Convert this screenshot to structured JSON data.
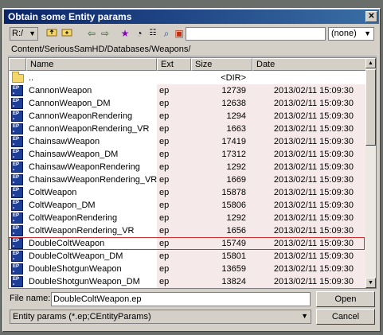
{
  "window": {
    "title": "Obtain some Entity params"
  },
  "toolbar": {
    "drive": "R:/",
    "path_value": "",
    "filter": "(none)",
    "icons": [
      "folder-up-icon",
      "folder-new-icon",
      "back-arrow-icon",
      "forward-arrow-icon",
      "star-icon",
      "clock-icon",
      "list-view-icon",
      "search-icon",
      "bookmark-icon"
    ]
  },
  "path": "Content/SeriousSamHD/Databases/Weapons/",
  "columns": {
    "name": "Name",
    "ext": "Ext",
    "size": "Size",
    "date": "Date"
  },
  "files": [
    {
      "name": "..",
      "ext": "",
      "size": "<DIR>",
      "date": ""
    },
    {
      "name": "CannonWeapon",
      "ext": "ep",
      "size": "12739",
      "date": "2013/02/11 15:09:30"
    },
    {
      "name": "CannonWeapon_DM",
      "ext": "ep",
      "size": "12638",
      "date": "2013/02/11 15:09:30"
    },
    {
      "name": "CannonWeaponRendering",
      "ext": "ep",
      "size": "1294",
      "date": "2013/02/11 15:09:30"
    },
    {
      "name": "CannonWeaponRendering_VR",
      "ext": "ep",
      "size": "1663",
      "date": "2013/02/11 15:09:30"
    },
    {
      "name": "ChainsawWeapon",
      "ext": "ep",
      "size": "17419",
      "date": "2013/02/11 15:09:30"
    },
    {
      "name": "ChainsawWeapon_DM",
      "ext": "ep",
      "size": "17312",
      "date": "2013/02/11 15:09:30"
    },
    {
      "name": "ChainsawWeaponRendering",
      "ext": "ep",
      "size": "1292",
      "date": "2013/02/11 15:09:30"
    },
    {
      "name": "ChainsawWeaponRendering_VR",
      "ext": "ep",
      "size": "1669",
      "date": "2013/02/11 15:09:30"
    },
    {
      "name": "ColtWeapon",
      "ext": "ep",
      "size": "15878",
      "date": "2013/02/11 15:09:30"
    },
    {
      "name": "ColtWeapon_DM",
      "ext": "ep",
      "size": "15806",
      "date": "2013/02/11 15:09:30"
    },
    {
      "name": "ColtWeaponRendering",
      "ext": "ep",
      "size": "1292",
      "date": "2013/02/11 15:09:30"
    },
    {
      "name": "ColtWeaponRendering_VR",
      "ext": "ep",
      "size": "1656",
      "date": "2013/02/11 15:09:30"
    },
    {
      "name": "DoubleColtWeapon",
      "ext": "ep",
      "size": "15749",
      "date": "2013/02/11 15:09:30"
    },
    {
      "name": "DoubleColtWeapon_DM",
      "ext": "ep",
      "size": "15801",
      "date": "2013/02/11 15:09:30"
    },
    {
      "name": "DoubleShotgunWeapon",
      "ext": "ep",
      "size": "13659",
      "date": "2013/02/11 15:09:30"
    },
    {
      "name": "DoubleShotgunWeapon_DM",
      "ext": "ep",
      "size": "13824",
      "date": "2013/02/11 15:09:30"
    }
  ],
  "selected_index": 13,
  "footer": {
    "file_name_label": "File name:",
    "file_name_value": "DoubleColtWeapon.ep",
    "open_label": "Open",
    "file_type": "Entity params (*.ep;CEntityParams)",
    "cancel_label": "Cancel"
  },
  "colors": {
    "title_start": "#0a246a",
    "title_end": "#3a6ea5",
    "row_tint": "#f6e9e9",
    "selection_border": "#d03030"
  }
}
